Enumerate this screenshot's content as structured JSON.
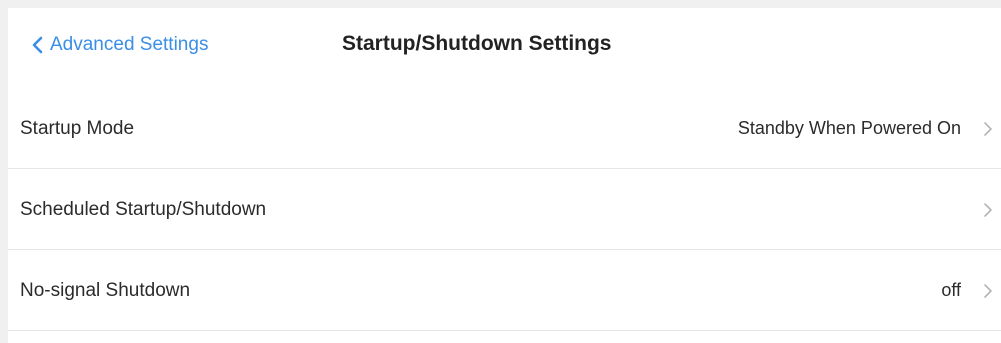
{
  "header": {
    "back_label": "Advanced Settings",
    "title": "Startup/Shutdown Settings"
  },
  "rows": [
    {
      "label": "Startup Mode",
      "value": "Standby When Powered On"
    },
    {
      "label": "Scheduled Startup/Shutdown",
      "value": ""
    },
    {
      "label": "No-signal Shutdown",
      "value": "off"
    }
  ],
  "colors": {
    "accent": "#3a8ee6",
    "text": "#2b2b2b",
    "divider": "#e6e6e6",
    "chevron": "#b5b5b5"
  },
  "icons": {
    "back": "chevron-left-icon",
    "row_arrow": "chevron-right-icon"
  }
}
